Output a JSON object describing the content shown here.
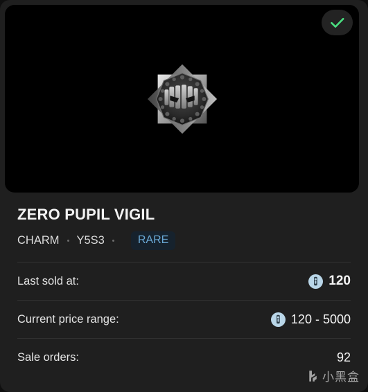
{
  "item": {
    "title": "ZERO PUPIL VIGIL",
    "category": "CHARM",
    "season": "Y5S3",
    "rarity": "RARE",
    "verified_icon": "check-icon",
    "artwork_icon": "eight-pointed-star-charm-icon"
  },
  "stats": [
    {
      "label": "Last sold at:",
      "value": "120",
      "has_currency_icon": true,
      "currency_icon": "r6-credits-coin-icon",
      "bold": true
    },
    {
      "label": "Current price range:",
      "value": "120 - 5000",
      "has_currency_icon": true,
      "currency_icon": "r6-credits-coin-icon",
      "bold": false
    },
    {
      "label": "Sale orders:",
      "value": "92",
      "has_currency_icon": false,
      "currency_icon": "",
      "bold": false
    }
  ],
  "watermark": {
    "logo_icon": "xiaoheihe-logo-icon",
    "text": "小黑盒"
  },
  "colors": {
    "page_background": "#1f1f1f",
    "hero_background": "#000000",
    "accent_check": "#4ade80",
    "rarity_text": "#6aa9d6",
    "rarity_background": "#16222d",
    "coin_background": "#b9d6e8",
    "divider": "#333333"
  }
}
